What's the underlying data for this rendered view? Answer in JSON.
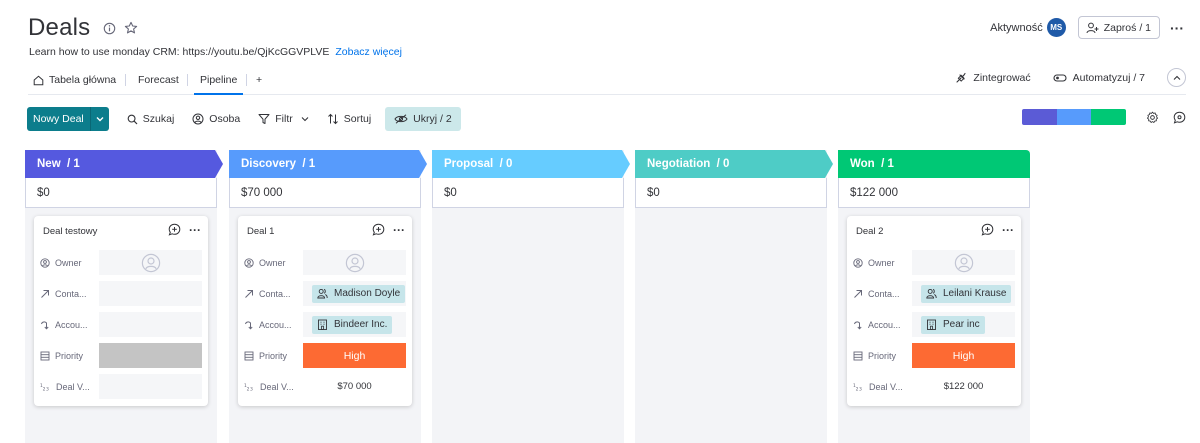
{
  "header": {
    "title": "Deals",
    "subtitle": "Learn how to use monday CRM: https://youtu.be/QjKcGGVPLVE",
    "see_more": "Zobacz więcej",
    "activity_label": "Aktywność",
    "avatar_initials": "MS",
    "invite_label": "Zaproś / 1"
  },
  "tabs": {
    "items": [
      {
        "label": "Tabela główna"
      },
      {
        "label": "Forecast"
      },
      {
        "label": "Pipeline"
      },
      {
        "label": "+"
      }
    ],
    "active": "Pipeline",
    "integrate_label": "Zintegrować",
    "automate_label": "Automatyzuj / 7"
  },
  "toolbar": {
    "new_label": "Nowy Deal",
    "search_label": "Szukaj",
    "person_label": "Osoba",
    "filter_label": "Filtr",
    "sort_label": "Sortuj",
    "hide_label": "Ukryj / 2",
    "progress_colors": [
      "#5b5bd6",
      "#579bfc",
      "#00c875"
    ]
  },
  "field_labels": {
    "owner": "Owner",
    "contact": "Conta...",
    "account": "Accou...",
    "priority": "Priority",
    "deal_value": "Deal V..."
  },
  "columns": [
    {
      "name": "New",
      "count": "/ 1",
      "total": "$0",
      "color": "#5559df",
      "card": {
        "name": "Deal testowy",
        "contact": "",
        "account": "",
        "priority": "",
        "value": ""
      }
    },
    {
      "name": "Discovery",
      "count": "/ 1",
      "total": "$70 000",
      "color": "#579bfc",
      "card": {
        "name": "Deal 1",
        "contact": "Madison Doyle",
        "account": "Bindeer Inc.",
        "priority": "High",
        "value": "$70 000"
      }
    },
    {
      "name": "Proposal",
      "count": "/ 0",
      "total": "$0",
      "color": "#66ccff"
    },
    {
      "name": "Negotiation",
      "count": "/ 0",
      "total": "$0",
      "color": "#4eccc6"
    },
    {
      "name": "Won",
      "count": "/ 1",
      "total": "$122 000",
      "color": "#00c875",
      "card": {
        "name": "Deal 2",
        "contact": "Leilani Krause",
        "account": "Pear inc",
        "priority": "High",
        "value": "$122 000"
      }
    }
  ]
}
